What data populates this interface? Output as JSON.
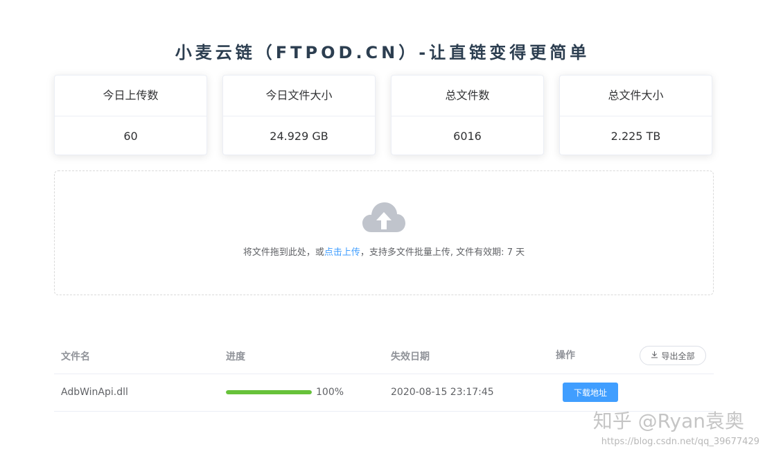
{
  "title": "小麦云链（FTPOD.CN）-让直链变得更简单",
  "stats": [
    {
      "label": "今日上传数",
      "value": "60"
    },
    {
      "label": "今日文件大小",
      "value": "24.929 GB"
    },
    {
      "label": "总文件数",
      "value": "6016"
    },
    {
      "label": "总文件大小",
      "value": "2.225 TB"
    }
  ],
  "upload": {
    "text_before": "将文件拖到此处，或",
    "link": "点击上传",
    "text_after": "，支持多文件批量上传, 文件有效期: 7 天",
    "icon": "cloud-upload-icon"
  },
  "table": {
    "headers": {
      "name": "文件名",
      "progress": "进度",
      "expire": "失效日期",
      "action": "操作"
    },
    "export_label": "导出全部",
    "rows": [
      {
        "name": "AdbWinApi.dll",
        "progress": 1.0,
        "progress_label": "100%",
        "expire": "2020-08-15 23:17:45",
        "action_label": "下载地址"
      }
    ]
  },
  "colors": {
    "accent": "#409eff",
    "progress": "#67c23a"
  },
  "watermark": {
    "main": "知乎 @Ryan袁奥",
    "url": "https://blog.csdn.net/qq_39677429"
  }
}
